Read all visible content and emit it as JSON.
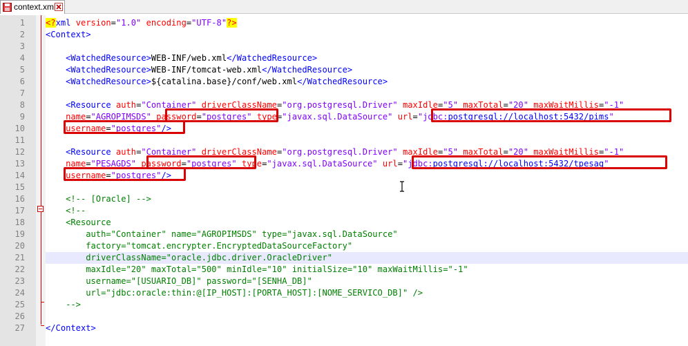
{
  "tab": {
    "title": "context.xml"
  },
  "colors": {
    "highlight_box": "#d80000",
    "tag": "#0000ff",
    "attribute": "#ff0000",
    "value": "#8000ff",
    "comment": "#008000"
  },
  "line_numbers": [
    "1",
    "2",
    "3",
    "4",
    "5",
    "6",
    "7",
    "8",
    "9",
    "10",
    "11",
    "12",
    "13",
    "14",
    "15",
    "16",
    "17",
    "18",
    "19",
    "20",
    "21",
    "22",
    "23",
    "24",
    "25",
    "26",
    "27"
  ],
  "lines": [
    [
      {
        "t": "pi",
        "v": "<?"
      },
      {
        "t": "tag",
        "v": "xml "
      },
      {
        "t": "attr",
        "v": "version"
      },
      {
        "t": "eq",
        "v": "="
      },
      {
        "t": "val",
        "v": "\"1.0\""
      },
      {
        "t": "txt",
        "v": " "
      },
      {
        "t": "attr",
        "v": "encoding"
      },
      {
        "t": "eq",
        "v": "="
      },
      {
        "t": "val",
        "v": "\"UTF-8\""
      },
      {
        "t": "pi",
        "v": "?>"
      }
    ],
    [
      {
        "t": "tag",
        "v": "<Context>"
      }
    ],
    [],
    [
      {
        "t": "txt",
        "v": "    "
      },
      {
        "t": "tag",
        "v": "<WatchedResource>"
      },
      {
        "t": "txt",
        "v": "WEB-INF/web.xml"
      },
      {
        "t": "tag",
        "v": "</WatchedResource>"
      }
    ],
    [
      {
        "t": "txt",
        "v": "    "
      },
      {
        "t": "tag",
        "v": "<WatchedResource>"
      },
      {
        "t": "txt",
        "v": "WEB-INF/tomcat-web.xml"
      },
      {
        "t": "tag",
        "v": "</WatchedResource>"
      }
    ],
    [
      {
        "t": "txt",
        "v": "    "
      },
      {
        "t": "tag",
        "v": "<WatchedResource>"
      },
      {
        "t": "txt",
        "v": "${catalina.base}/conf/web.xml"
      },
      {
        "t": "tag",
        "v": "</WatchedResource>"
      }
    ],
    [],
    [
      {
        "t": "txt",
        "v": "    "
      },
      {
        "t": "tag",
        "v": "<Resource "
      },
      {
        "t": "attr",
        "v": "auth"
      },
      {
        "t": "eq",
        "v": "="
      },
      {
        "t": "val",
        "v": "\"Container\""
      },
      {
        "t": "txt",
        "v": " "
      },
      {
        "t": "attr",
        "v": "driverClassName"
      },
      {
        "t": "eq",
        "v": "="
      },
      {
        "t": "val",
        "v": "\"org.postgresql.Driver\""
      },
      {
        "t": "txt",
        "v": " "
      },
      {
        "t": "attr",
        "v": "maxIdle"
      },
      {
        "t": "eq",
        "v": "="
      },
      {
        "t": "val",
        "v": "\"5\""
      },
      {
        "t": "txt",
        "v": " "
      },
      {
        "t": "attr",
        "v": "maxTotal"
      },
      {
        "t": "eq",
        "v": "="
      },
      {
        "t": "val",
        "v": "\"20\""
      },
      {
        "t": "txt",
        "v": " "
      },
      {
        "t": "attr",
        "v": "maxWaitMillis"
      },
      {
        "t": "eq",
        "v": "="
      },
      {
        "t": "val",
        "v": "\"-1\""
      }
    ],
    [
      {
        "t": "txt",
        "v": "    "
      },
      {
        "t": "attr",
        "v": "name"
      },
      {
        "t": "eq",
        "v": "="
      },
      {
        "t": "val",
        "v": "\"AGROPIMSDS\""
      },
      {
        "t": "txt",
        "v": " "
      },
      {
        "t": "attr",
        "v": "password"
      },
      {
        "t": "eq",
        "v": "="
      },
      {
        "t": "val",
        "v": "\"postgres\""
      },
      {
        "t": "txt",
        "v": " "
      },
      {
        "t": "attr",
        "v": "type"
      },
      {
        "t": "eq",
        "v": "="
      },
      {
        "t": "val",
        "v": "\"javax.sql.DataSource\""
      },
      {
        "t": "txt",
        "v": " "
      },
      {
        "t": "attr",
        "v": "url"
      },
      {
        "t": "eq",
        "v": "="
      },
      {
        "t": "val",
        "v": "\"jdbc:"
      },
      {
        "t": "link",
        "v": "postgresql://localhost:5432/pims"
      },
      {
        "t": "val",
        "v": "\""
      }
    ],
    [
      {
        "t": "txt",
        "v": "    "
      },
      {
        "t": "attr",
        "v": "username"
      },
      {
        "t": "eq",
        "v": "="
      },
      {
        "t": "val",
        "v": "\"postgres\""
      },
      {
        "t": "tag",
        "v": "/>"
      }
    ],
    [],
    [
      {
        "t": "txt",
        "v": "    "
      },
      {
        "t": "tag",
        "v": "<Resource "
      },
      {
        "t": "attr",
        "v": "auth"
      },
      {
        "t": "eq",
        "v": "="
      },
      {
        "t": "val",
        "v": "\"Container\""
      },
      {
        "t": "txt",
        "v": " "
      },
      {
        "t": "attr",
        "v": "driverClassName"
      },
      {
        "t": "eq",
        "v": "="
      },
      {
        "t": "val",
        "v": "\"org.postgresql.Driver\""
      },
      {
        "t": "txt",
        "v": " "
      },
      {
        "t": "attr",
        "v": "maxIdle"
      },
      {
        "t": "eq",
        "v": "="
      },
      {
        "t": "val",
        "v": "\"5\""
      },
      {
        "t": "txt",
        "v": " "
      },
      {
        "t": "attr",
        "v": "maxTotal"
      },
      {
        "t": "eq",
        "v": "="
      },
      {
        "t": "val",
        "v": "\"20\""
      },
      {
        "t": "txt",
        "v": " "
      },
      {
        "t": "attr",
        "v": "maxWaitMillis"
      },
      {
        "t": "eq",
        "v": "="
      },
      {
        "t": "val",
        "v": "\"-1\""
      }
    ],
    [
      {
        "t": "txt",
        "v": "    "
      },
      {
        "t": "attr",
        "v": "name"
      },
      {
        "t": "eq",
        "v": "="
      },
      {
        "t": "val",
        "v": "\"PESAGDS\""
      },
      {
        "t": "txt",
        "v": " "
      },
      {
        "t": "attr",
        "v": "password"
      },
      {
        "t": "eq",
        "v": "="
      },
      {
        "t": "val",
        "v": "\"postgres\""
      },
      {
        "t": "txt",
        "v": " "
      },
      {
        "t": "attr",
        "v": "type"
      },
      {
        "t": "eq",
        "v": "="
      },
      {
        "t": "val",
        "v": "\"javax.sql.DataSource\""
      },
      {
        "t": "txt",
        "v": " "
      },
      {
        "t": "attr",
        "v": "url"
      },
      {
        "t": "eq",
        "v": "="
      },
      {
        "t": "val",
        "v": "\"jdbc:"
      },
      {
        "t": "link",
        "v": "postgresql://localhost:5432/tpesag"
      },
      {
        "t": "val",
        "v": "\""
      }
    ],
    [
      {
        "t": "txt",
        "v": "    "
      },
      {
        "t": "attr",
        "v": "username"
      },
      {
        "t": "eq",
        "v": "="
      },
      {
        "t": "val",
        "v": "\"postgres\""
      },
      {
        "t": "tag",
        "v": "/>"
      }
    ],
    [],
    [
      {
        "t": "txt",
        "v": "    "
      },
      {
        "t": "com",
        "v": "<!-- [Oracle] -->"
      }
    ],
    [
      {
        "t": "txt",
        "v": "    "
      },
      {
        "t": "com",
        "v": "<!--"
      }
    ],
    [
      {
        "t": "txt",
        "v": "    "
      },
      {
        "t": "com",
        "v": "<Resource"
      }
    ],
    [
      {
        "t": "txt",
        "v": "        "
      },
      {
        "t": "com",
        "v": "auth=\"Container\" name=\"AGROPIMSDS\" type=\"javax.sql.DataSource\""
      }
    ],
    [
      {
        "t": "txt",
        "v": "        "
      },
      {
        "t": "com",
        "v": "factory=\"tomcat.encrypter.EncryptedDataSourceFactory\""
      }
    ],
    [
      {
        "t": "txt",
        "v": "        "
      },
      {
        "t": "com",
        "v": "driverClassName=\"oracle.jdbc.driver.OracleDriver\""
      }
    ],
    [
      {
        "t": "txt",
        "v": "        "
      },
      {
        "t": "com",
        "v": "maxIdle=\"20\" maxTotal=\"500\" minIdle=\"10\" initialSize=\"10\" maxWaitMillis=\"-1\""
      }
    ],
    [
      {
        "t": "txt",
        "v": "        "
      },
      {
        "t": "com",
        "v": "username=\"[USUARIO_DB]\" password=\"[SENHA_DB]\""
      }
    ],
    [
      {
        "t": "txt",
        "v": "        "
      },
      {
        "t": "com",
        "v": "url=\"jdbc:oracle:thin:@[IP_HOST]:[PORTA_HOST]:[NOME_SERVICO_DB]\" />"
      }
    ],
    [
      {
        "t": "txt",
        "v": "    "
      },
      {
        "t": "com",
        "v": "-->"
      }
    ],
    [],
    [
      {
        "t": "tag",
        "v": "</Context>"
      }
    ]
  ]
}
